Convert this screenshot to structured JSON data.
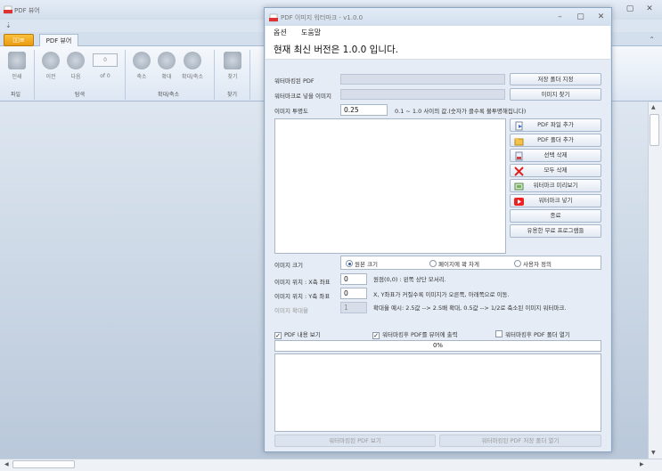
{
  "viewer": {
    "title": "PDF 뷰어",
    "quick_access": "⇣",
    "file_tab": "▯▯≡",
    "tab_viewer": "PDF 뷰어",
    "window_controls": [
      "–",
      "▢",
      "✕"
    ],
    "ribbon_collapse": "⌃",
    "buttons": {
      "print": "인쇄",
      "prev": "이전",
      "next": "다음",
      "page_input": "0",
      "of_pages": "of 0",
      "zoom_out": "축소",
      "zoom_in": "확대",
      "zoom_fit": "확대/축소",
      "find": "찾기"
    },
    "groups": {
      "file": "파일",
      "navigate": "탐색",
      "zoom": "확대/축소",
      "find": "찾기"
    }
  },
  "dialog": {
    "title": "PDF 이미지 워터마크 - v1.0.0",
    "window_controls": [
      "–",
      "▢",
      "✕"
    ],
    "menu": [
      "옵션",
      "도움말"
    ],
    "version_message": "현재 최신 버전은 1.0.0 입니다.",
    "labels": {
      "watermark_pdf": "워터마킹된 PDF",
      "watermark_image": "워터마크로 넣을 이미지",
      "image_opacity": "이미지 투명도",
      "opacity_hint": "0.1 ~ 1.0 사이의 값.(숫자가 클수록 불투명해집니다)",
      "image_size": "이미지 크기",
      "image_pos_x": "이미지 위치 : X축 좌표",
      "image_pos_y": "이미지 위치 : Y축 좌표",
      "image_zoom": "이미지 확대율",
      "origin_hint": "원점(0,0) : 왼쪽 상단 모서리.",
      "xy_hint": "X, Y좌표가 커질수록 이미지가 오른쪽, 아래쪽으로 이동.",
      "zoom_hint": "확대율 예시: 2.5값 --> 2.5배 확대, 0.5값 --> 1/2로 축소된 이미지 워터마크."
    },
    "values": {
      "watermark_pdf": "",
      "watermark_image": "",
      "opacity": "0.25",
      "pos_x": "0",
      "pos_y": "0",
      "zoom": "1"
    },
    "buttons": {
      "save_folder": "저장 폴더 지정",
      "find_image": "이미지 찾기",
      "add_pdf_file": "PDF 파일 추가",
      "add_pdf_folder": "PDF 폴더 추가",
      "delete_selected": "선택 삭제",
      "delete_all": "모두 삭제",
      "preview_watermark": "워터마크 미리보기",
      "insert_watermark": "워터마크 넣기",
      "exit": "종료",
      "useful_programs": "유용한 무료 프로그램들",
      "view_pdf": "워터마킹된 PDF 보기",
      "open_folder": "워터마킹된 PDF 저장 폴더 열기"
    },
    "size_options": [
      {
        "label": "원본 크기",
        "selected": true
      },
      {
        "label": "페이지에 꽉 차게",
        "selected": false
      },
      {
        "label": "사용자 정의",
        "selected": false
      }
    ],
    "checkboxes": {
      "show_pdf_content": {
        "label": "PDF 내용 보기",
        "checked": true
      },
      "print_to_viewer": {
        "label": "워터마킹후 PDF를 뷰어에 출력",
        "checked": true
      },
      "open_pdf_folder": {
        "label": "워터마킹후 PDF 폴더 열기",
        "checked": false
      }
    },
    "progress": {
      "text": "0%",
      "value": 0
    }
  }
}
